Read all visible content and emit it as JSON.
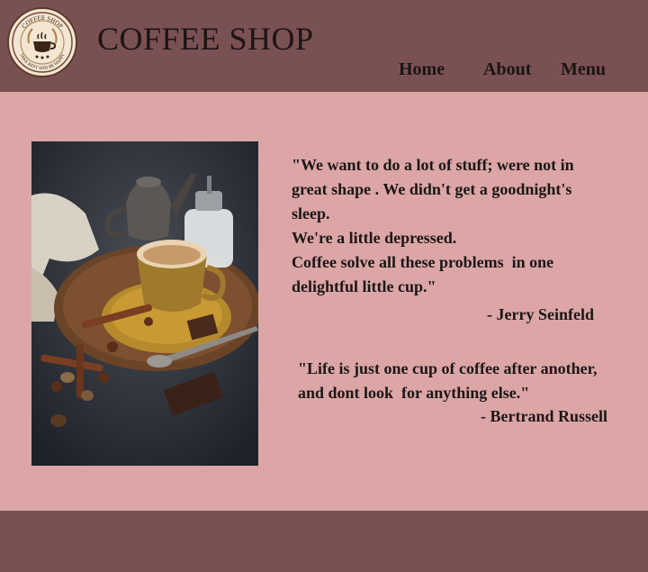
{
  "logo": {
    "top_text": "COFFEE SHOP",
    "bottom_text": "TAKE REST AND BE HAPPY"
  },
  "header": {
    "title": "COFFEE SHOP"
  },
  "nav": {
    "home": "Home",
    "about": "About",
    "menu": "Menu"
  },
  "quotes": {
    "q1_lines": [
      "\"We want to do a lot of stuff; were not in",
      "great shape . We didn't get a goodnight's",
      "sleep.",
      "We're a little depressed.",
      "Coffee solve all these problems  in one",
      "delightful little cup.\""
    ],
    "q1_author": "- Jerry Seinfeld",
    "q2_lines": [
      "\"Life is just one cup of coffee after another,",
      "and dont look  for anything else.\""
    ],
    "q2_author": "- Bertrand Russell"
  },
  "colors": {
    "header_bg": "#7a5153",
    "page_bg": "#dca6a6",
    "footer_bg": "#7a5153"
  }
}
